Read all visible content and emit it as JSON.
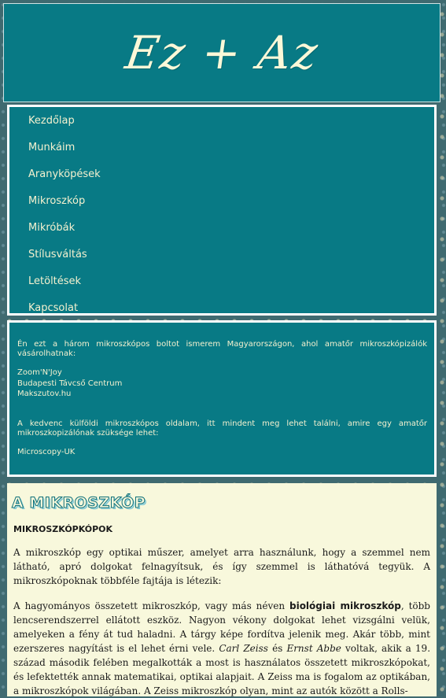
{
  "header": {
    "logo_text": "Ez + Az"
  },
  "nav": {
    "items": [
      "Kezdőlap",
      "Munkáim",
      "Aranyköpések",
      "Mikroszkóp",
      "Mikróbák",
      "Stílusváltás",
      "Letöltések",
      "Kapcsolat"
    ]
  },
  "aside": {
    "intro": "Én ezt a három mikroszkópos boltot ismerem Magyarországon, ahol amatőr mikroszkópizálók vásárolhatnak:",
    "shops": [
      "Zoom'N'Joy",
      "Budapesti Távcső Centrum",
      "Makszutov.hu"
    ],
    "favorite_intro": "A kedvenc külföldi mikroszkópos oldalam, itt mindent meg lehet találni, amire egy amatőr mikroszkopizálónak szüksége lehet:",
    "favorite_link": "Microscopy-UK"
  },
  "main": {
    "title": "A MIKROSZKÓP",
    "section_title": "MIKROSZKÓPKÓPOK",
    "para1": "A mikroszkóp egy optikai műszer, amelyet arra használunk, hogy a szemmel nem látható, apró dolgokat felnagyítsuk, és így szemmel is láthatóvá tegyük. A mikroszkópoknak többféle fajtája is létezik:",
    "para2_a": "A hagyományos összetett mikroszkóp, vagy más néven ",
    "para2_bold": "biológiai mikroszkóp",
    "para2_b": ", több lencserendszerrel ellátott eszköz. Nagyon vékony dolgokat lehet vizsgálni velük, amelyeken a fény át tud haladni. A tárgy képe fordítva jelenik meg. Akár több, mint ezerszeres nagyítást is el lehet érni vele. ",
    "para2_name1": "Carl Zeiss",
    "para2_c": " és ",
    "para2_name2": "Ernst Abbe",
    "para2_d": " voltak, akik a 19. század második felében megalkották a most is használatos összetett mikroszkópokat, és lefektették annak matematikai, optikai alapjait. A Zeiss ma is fogalom az optikában, a mikroszkópok világában. A Zeiss mikroszkóp olyan, mint az autók között a Rolls-"
  }
}
